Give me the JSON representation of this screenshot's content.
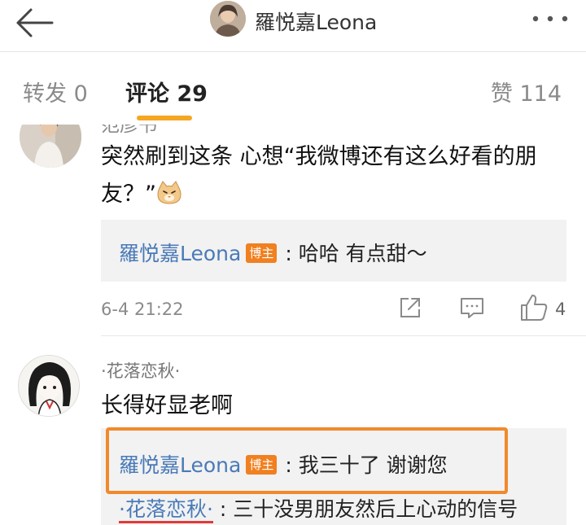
{
  "header": {
    "title": "羅悦嘉Leona",
    "back_icon": "back-arrow-icon",
    "more_icon": "more-dots-icon"
  },
  "tabs": {
    "repost": "转发 0",
    "comments": "评论 29",
    "likes": "赞 114",
    "active_color": "#f5a623"
  },
  "comments": [
    {
      "clipped_name": "范彦书",
      "text": "突然刷到这条 心想“我微博还有这么好看的朋友？”",
      "emoji": "cat-emoji-icon",
      "reply": {
        "name": "羅悦嘉Leona",
        "badge": "博主",
        "sep": ":",
        "text": "哈哈 有点甜～"
      },
      "time": "6-4 21:22",
      "likes": "4"
    },
    {
      "name": "·花落恋秋·",
      "text": "长得好显老啊",
      "reply": {
        "name": "羅悦嘉Leona",
        "badge": "博主",
        "sep": ":",
        "text": "我三十了 谢谢您"
      },
      "reply2": {
        "name": "·花落恋秋·",
        "sep": ":",
        "text": "三十没男朋友然后上心动的信号"
      }
    }
  ],
  "colors": {
    "link_blue": "#4a7ab8",
    "badge_orange": "#f08020",
    "highlight_orange": "#f08a2c",
    "underline_red": "#e03a3a"
  }
}
